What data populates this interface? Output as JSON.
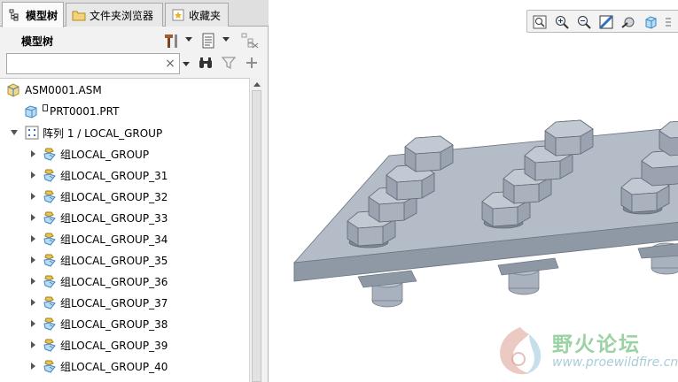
{
  "tabs": [
    {
      "label": "模型树",
      "icon": "model-tree-icon",
      "active": true
    },
    {
      "label": "文件夹浏览器",
      "icon": "folder-browser-icon",
      "active": false
    },
    {
      "label": "收藏夹",
      "icon": "favorites-icon",
      "active": false
    }
  ],
  "panel": {
    "title": "模型树",
    "toolbar_icons": [
      "tools-icon",
      "settings-list-icon",
      "filter-columns-icon"
    ]
  },
  "search": {
    "value": "",
    "placeholder": "",
    "clear_glyph": "×",
    "action_icons": [
      "binoculars-icon",
      "filter-icon",
      "add-icon"
    ]
  },
  "tree": {
    "root": {
      "label": "ASM0001.ASM",
      "icon": "assembly-icon"
    },
    "part": {
      "label": "PRT0001.PRT",
      "icon": "part-icon"
    },
    "pattern": {
      "label": "阵列 1 / LOCAL_GROUP",
      "icon": "pattern-icon",
      "expanded": true
    },
    "groups": [
      {
        "label": "组LOCAL_GROUP"
      },
      {
        "label": "组LOCAL_GROUP_31"
      },
      {
        "label": "组LOCAL_GROUP_32"
      },
      {
        "label": "组LOCAL_GROUP_33"
      },
      {
        "label": "组LOCAL_GROUP_34"
      },
      {
        "label": "组LOCAL_GROUP_35"
      },
      {
        "label": "组LOCAL_GROUP_36"
      },
      {
        "label": "组LOCAL_GROUP_37"
      },
      {
        "label": "组LOCAL_GROUP_38"
      },
      {
        "label": "组LOCAL_GROUP_39"
      },
      {
        "label": "组LOCAL_GROUP_40"
      }
    ]
  },
  "view_toolbar": [
    "refit-icon",
    "zoom-in-icon",
    "zoom-out-icon",
    "repaint-icon",
    "display-style-icon",
    "saved-views-icon"
  ],
  "watermark": {
    "title": "野火论坛",
    "url": "www.proewildfire.cn"
  },
  "colors": {
    "model": "#a6afbb",
    "model_dark": "#7d8794",
    "model_light": "#c3cad3",
    "accent": "#3a7bd5"
  }
}
